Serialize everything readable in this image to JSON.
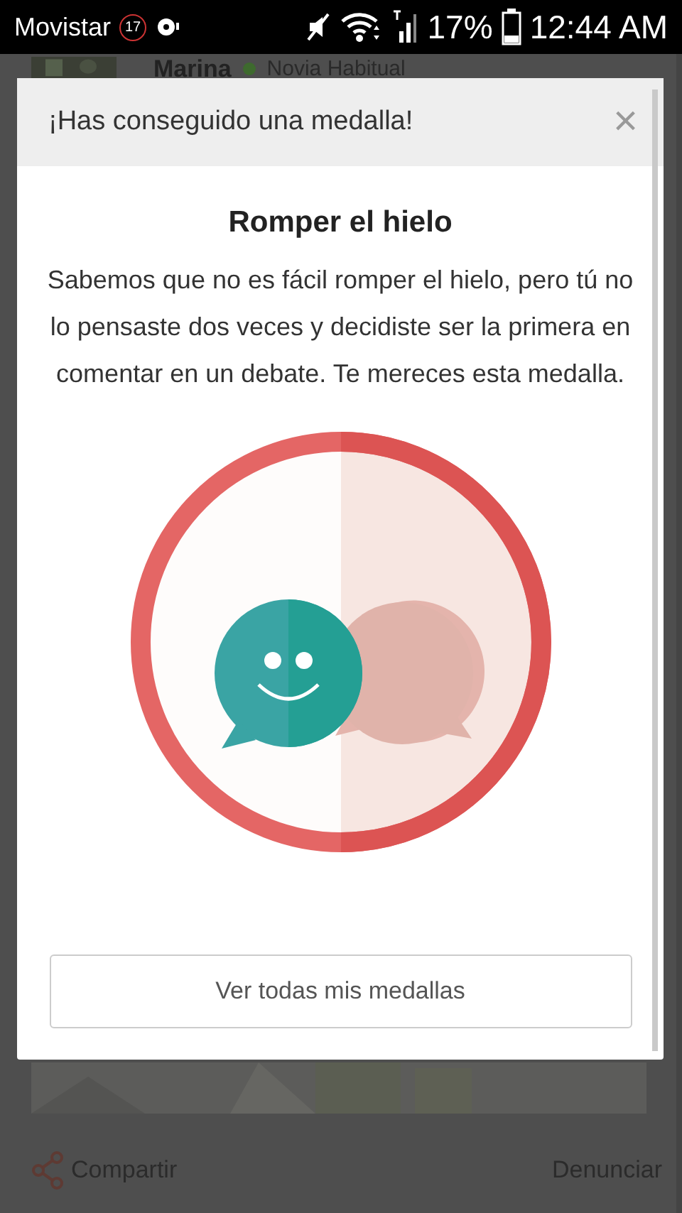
{
  "status_bar": {
    "carrier": "Movistar",
    "notification_count": "17",
    "battery": "17%",
    "time": "12:44 AM"
  },
  "post": {
    "author": "Marina",
    "rank": "Novia Habitual",
    "share": "Compartir",
    "report": "Denunciar"
  },
  "dialog": {
    "header": "¡Has conseguido una medalla!",
    "close": "×",
    "title": "Romper el hielo",
    "message": "Sabemos que no es fácil romper el hielo, pero tú no lo pensaste dos veces y decidiste ser la primera en comentar en un debate. Te mereces esta medalla.",
    "button": "Ver todas mis medallas"
  }
}
